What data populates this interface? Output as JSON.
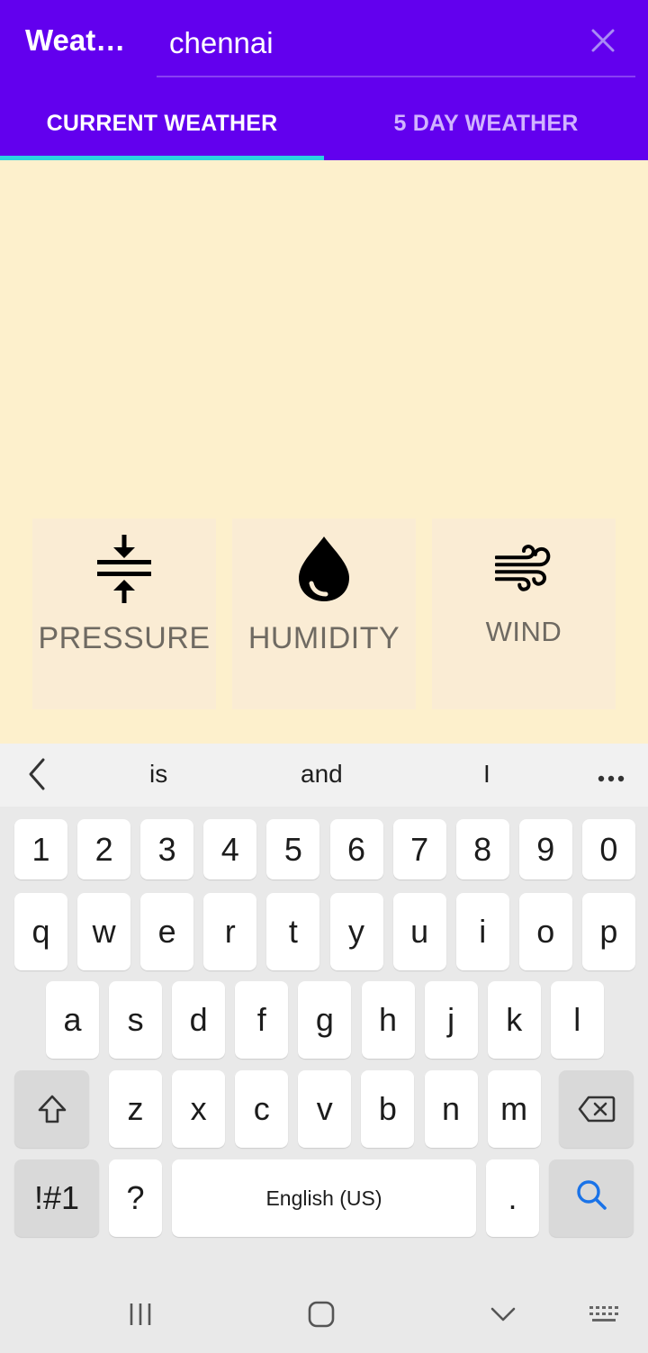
{
  "app_bar": {
    "title": "Weat…",
    "search_value": "chennai",
    "close_icon": "close-icon",
    "background": "#6200ee"
  },
  "tabs": [
    {
      "label": "CURRENT WEATHER",
      "active": true
    },
    {
      "label": "5 DAY WEATHER",
      "active": false
    }
  ],
  "cards": [
    {
      "label": "PRESSURE",
      "icon": "pressure-icon"
    },
    {
      "label": "HUMIDITY",
      "icon": "water-drop-icon"
    },
    {
      "label": "WIND",
      "icon": "wind-icon"
    }
  ],
  "keyboard": {
    "suggestions": [
      "is",
      "and",
      "I"
    ],
    "number_row": [
      "1",
      "2",
      "3",
      "4",
      "5",
      "6",
      "7",
      "8",
      "9",
      "0"
    ],
    "row1": [
      "q",
      "w",
      "e",
      "r",
      "t",
      "y",
      "u",
      "i",
      "o",
      "p"
    ],
    "row2": [
      "a",
      "s",
      "d",
      "f",
      "g",
      "h",
      "j",
      "k",
      "l"
    ],
    "row3": [
      "z",
      "x",
      "c",
      "v",
      "b",
      "n",
      "m"
    ],
    "symbols_label": "!#1",
    "question_label": "?",
    "space_label": "English (US)",
    "period_label": "."
  }
}
